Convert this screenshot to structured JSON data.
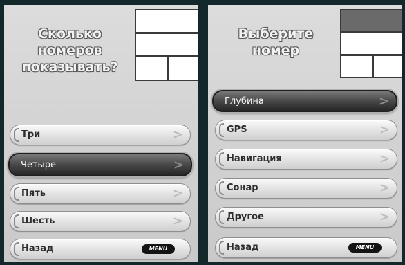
{
  "left_screen": {
    "prompt_lines": [
      "Сколько",
      "номеров",
      "показывать?"
    ],
    "menu": [
      {
        "label": "Три"
      },
      {
        "label": "Четыре",
        "selected": true
      },
      {
        "label": "Пять"
      },
      {
        "label": "Шесть"
      },
      {
        "label": "Назад",
        "badge": "MENU"
      }
    ]
  },
  "right_screen": {
    "prompt_lines": [
      "Выберите",
      "номер"
    ],
    "menu": [
      {
        "label": "Глубина",
        "selected": true
      },
      {
        "label": "GPS"
      },
      {
        "label": "Навигация"
      },
      {
        "label": "Сонар"
      },
      {
        "label": "Другое"
      },
      {
        "label": "Назад",
        "badge": "MENU"
      }
    ]
  },
  "icons": {
    "chevron": "chevron-right-icon",
    "bracket": "bracket-icon"
  }
}
